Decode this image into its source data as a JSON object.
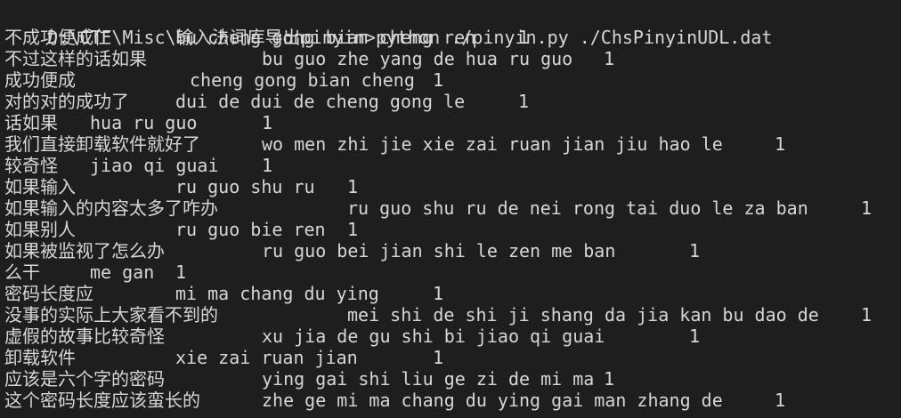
{
  "prompt": "D:\\CTF\\Misc\\输入法词库导出pinyin>python ./pinyin.py ./ChsPinyinUDL.dat",
  "rows": [
    {
      "word": "不成功便成仁",
      "pinyin": "bu cheng gong bian cheng ren",
      "count": "1"
    },
    {
      "word": "不过这样的话如果",
      "pinyin": "bu guo zhe yang de hua ru guo",
      "count": "1"
    },
    {
      "word": "成功便成",
      "pinyin": "cheng gong bian cheng",
      "count": "1"
    },
    {
      "word": "对的对的成功了",
      "pinyin": "dui de dui de cheng gong le",
      "count": "1"
    },
    {
      "word": "话如果",
      "pinyin": "hua ru guo",
      "count": "1"
    },
    {
      "word": "我们直接卸载软件就好了",
      "pinyin": "wo men zhi jie xie zai ruan jian jiu hao le",
      "count": "1"
    },
    {
      "word": "较奇怪",
      "pinyin": "jiao qi guai",
      "count": "1"
    },
    {
      "word": "如果输入",
      "pinyin": "ru guo shu ru",
      "count": "1"
    },
    {
      "word": "如果输入的内容太多了咋办",
      "pinyin": "ru guo shu ru de nei rong tai duo le za ban",
      "count": "1"
    },
    {
      "word": "如果别人",
      "pinyin": "ru guo bie ren",
      "count": "1"
    },
    {
      "word": "如果被监视了怎么办",
      "pinyin": "ru guo bei jian shi le zen me ban",
      "count": "1"
    },
    {
      "word": "么干",
      "pinyin": "me gan",
      "count": "1"
    },
    {
      "word": "密码长度应",
      "pinyin": "mi ma chang du ying",
      "count": "1"
    },
    {
      "word": "没事的实际上大家看不到的",
      "pinyin": "mei shi de shi ji shang da jia kan bu dao de",
      "count": "1"
    },
    {
      "word": "虚假的故事比较奇怪",
      "pinyin": "xu jia de gu shi bi jiao qi guai",
      "count": "1"
    },
    {
      "word": "卸载软件",
      "pinyin": "xie zai ruan jian",
      "count": "1"
    },
    {
      "word": "应该是六个字的密码",
      "pinyin": "ying gai shi liu ge zi de mi ma",
      "count": "1"
    },
    {
      "word": "这个密码长度应该蛮长的",
      "pinyin": "zhe ge mi ma chang du ying gai man zhang de",
      "count": "1"
    }
  ]
}
